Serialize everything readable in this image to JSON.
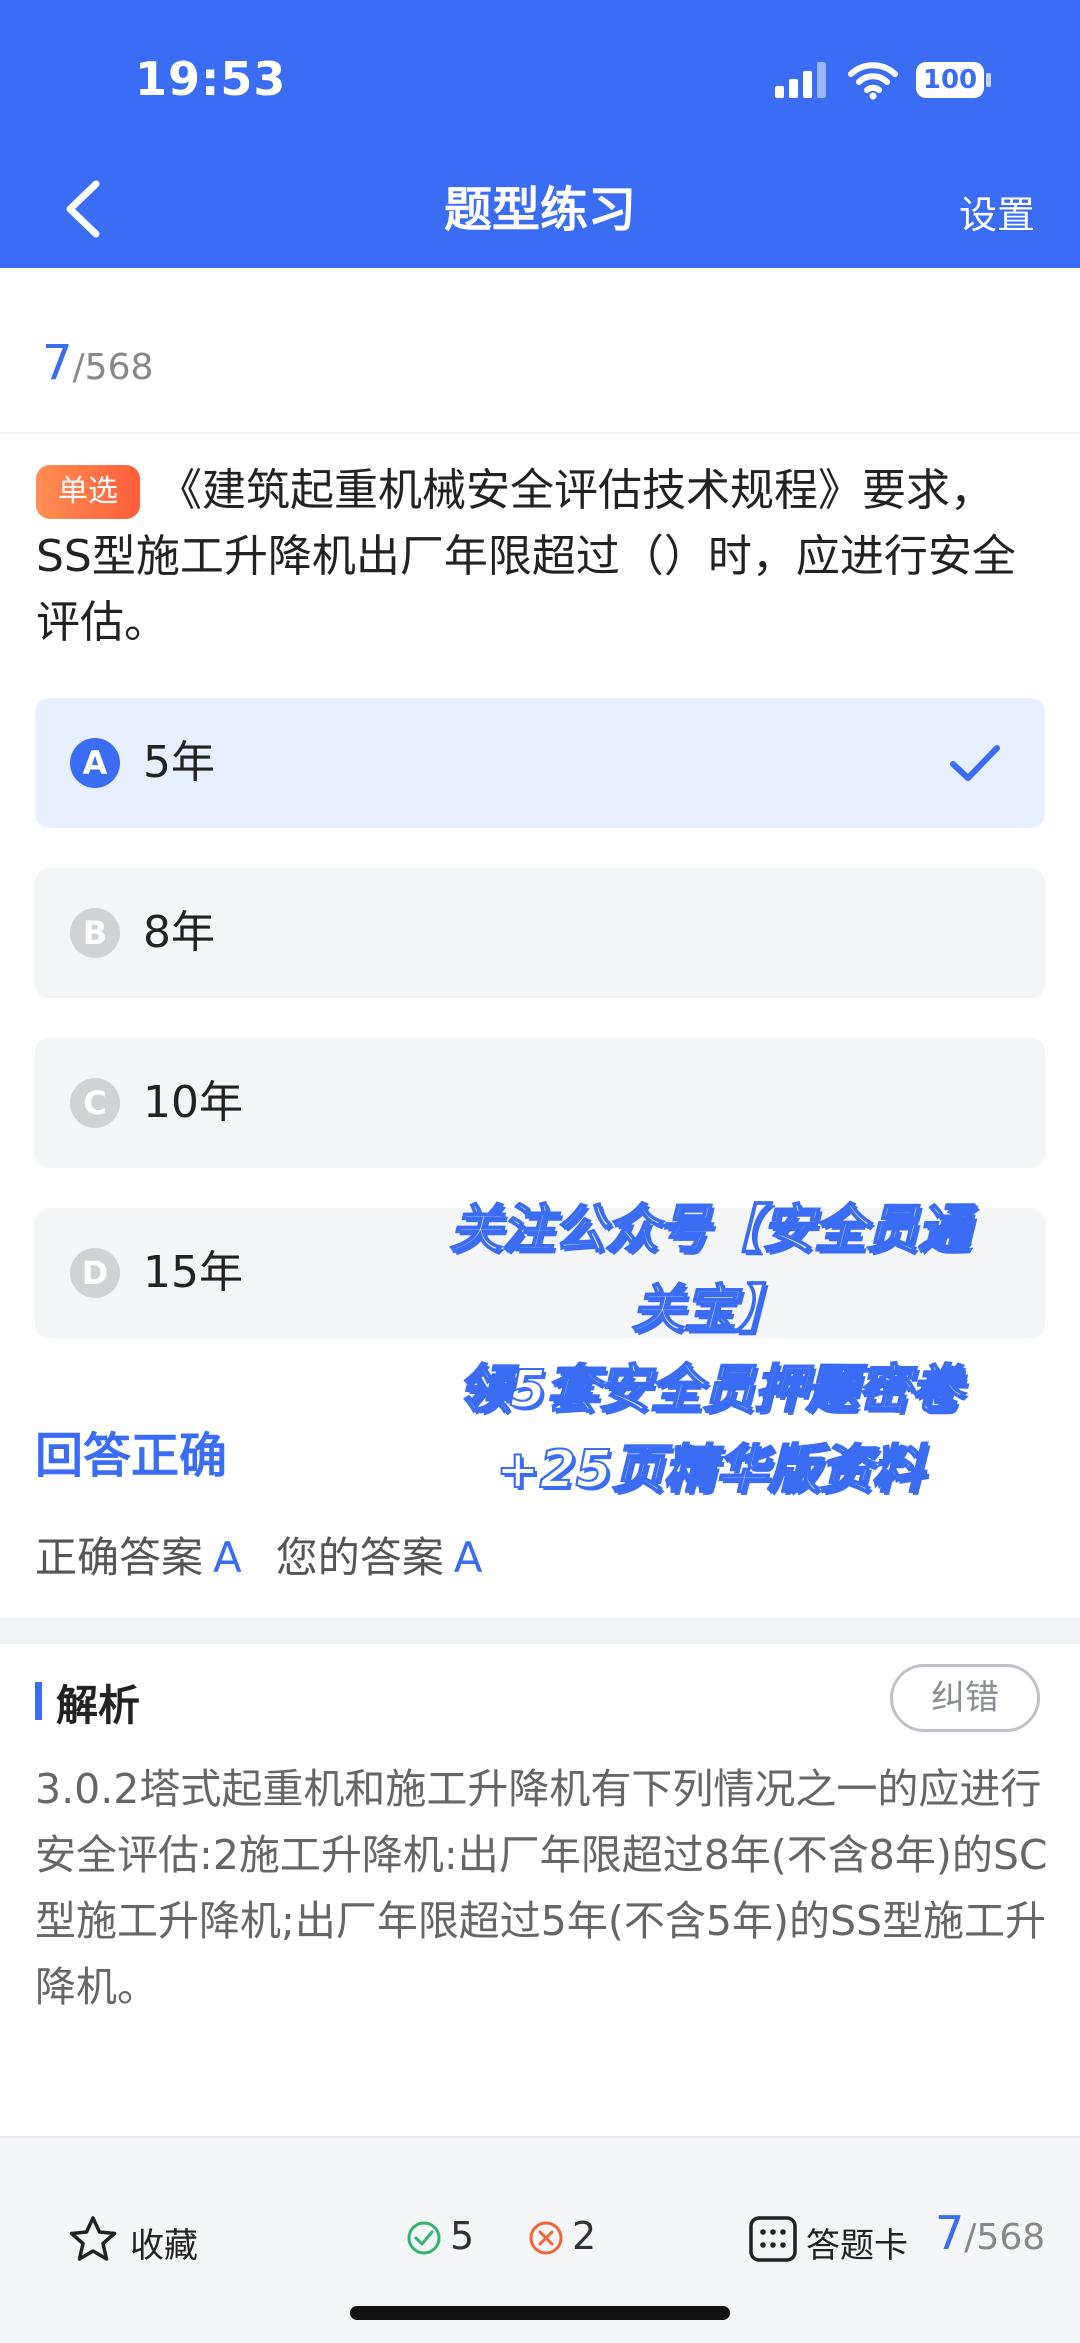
{
  "status": {
    "time": "19:53",
    "battery": "100"
  },
  "nav": {
    "title": "题型练习",
    "settings": "设置"
  },
  "progress": {
    "current": "7",
    "total": "/568"
  },
  "question": {
    "type_badge": "单选",
    "text": "《建筑起重机械安全评估技术规程》要求，SS型施工升降机出厂年限超过（）时，应进行安全评估。"
  },
  "options": [
    {
      "letter": "A",
      "text": "5年",
      "selected": true
    },
    {
      "letter": "B",
      "text": "8年",
      "selected": false
    },
    {
      "letter": "C",
      "text": "10年",
      "selected": false
    },
    {
      "letter": "D",
      "text": "15年",
      "selected": false
    }
  ],
  "watermark": {
    "line1": "关注公众号【安全员通",
    "line2": "关宝】",
    "line3": "领5套安全员押题密卷",
    "line4": "+25页精华版资料"
  },
  "result": {
    "title": "回答正确",
    "correct_label": "正确答案",
    "correct_value": "A",
    "yours_label": "您的答案",
    "yours_value": "A"
  },
  "analysis": {
    "title": "解析",
    "report_button": "纠错",
    "text": "3.0.2塔式起重机和施工升降机有下列情况之一的应进行安全评估:2施工升降机:出厂年限超过8年(不含8年)的SC型施工升降机;出厂年限超过5年(不含5年)的SS型施工升降机。"
  },
  "bottom": {
    "favorite_label": "收藏",
    "correct_count": "5",
    "wrong_count": "2",
    "answer_card_label": "答题卡",
    "progress_current": "7",
    "progress_total": "/568"
  },
  "colors": {
    "accent": "#3A6CF4",
    "badge": "#FF6A3D",
    "correct": "#34B36B",
    "wrong": "#F0643C"
  }
}
